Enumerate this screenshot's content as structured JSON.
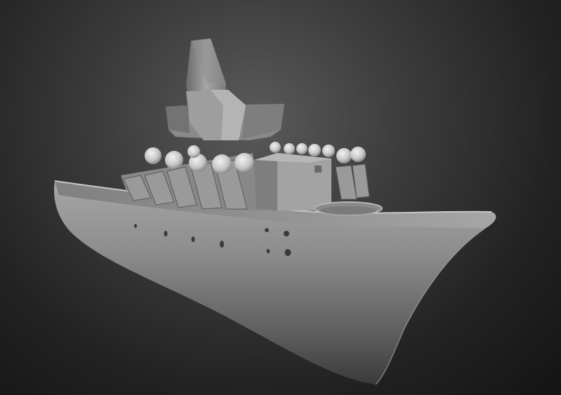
{
  "scene": {
    "subject": "grey-clay-warship-render",
    "background_color": "#2a2a2a",
    "hull_color": "#8a8a8a",
    "superstructure_color": "#9c9c9c",
    "turret_color": "#d8d8d8"
  },
  "turrets": {
    "forward_bank_count": 6,
    "aft_bank_count": 6
  },
  "portholes": {
    "count": 10
  }
}
